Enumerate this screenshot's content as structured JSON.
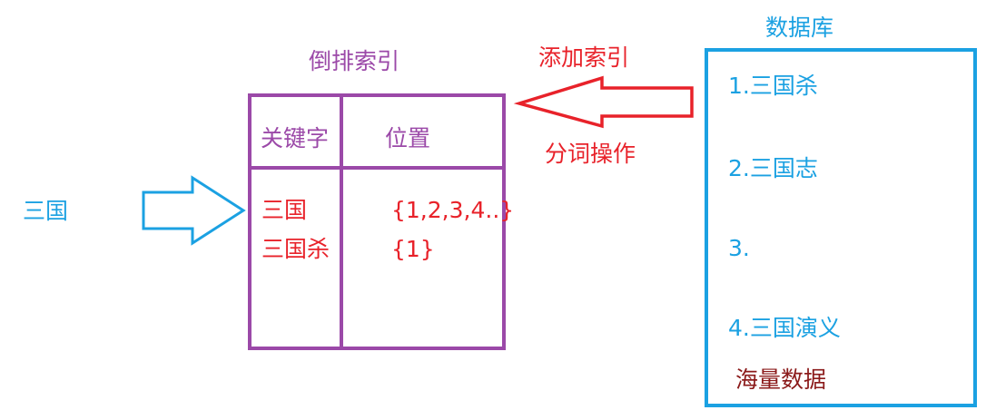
{
  "colors": {
    "query": "#1ba1e2",
    "index": "#9b49a8",
    "entries": "#e8222a",
    "database": "#1ba1e2",
    "note": "#8b1a1a"
  },
  "query": {
    "label": "三国"
  },
  "inverted_index": {
    "title": "倒排索引",
    "headers": [
      "关键字",
      "位置"
    ],
    "rows": [
      {
        "keyword": "三国",
        "positions": "{1,2,3,4..}"
      },
      {
        "keyword": "三国杀",
        "positions": "{1}"
      }
    ]
  },
  "annotations": {
    "add_index": "添加索引",
    "tokenize": "分词操作"
  },
  "database": {
    "title": "数据库",
    "items": [
      "1.三国杀",
      "2.三国志",
      "3.",
      "4.三国演义"
    ],
    "footer": "海量数据"
  }
}
